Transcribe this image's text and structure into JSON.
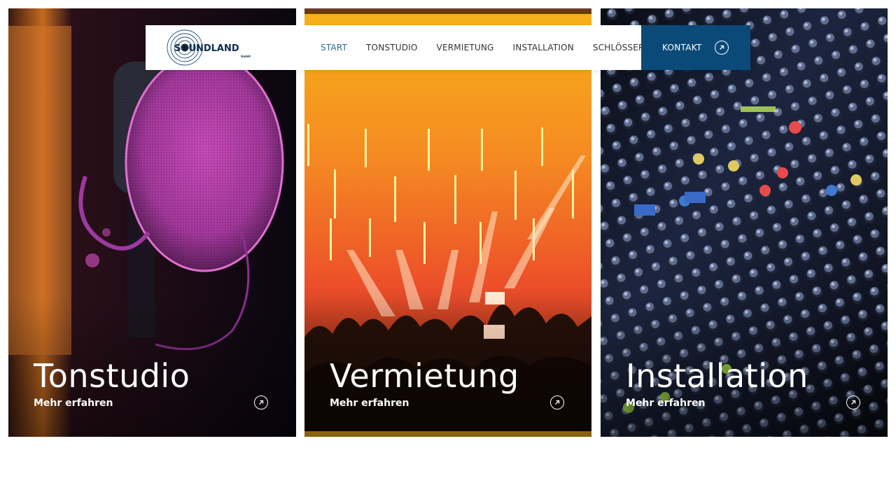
{
  "brand": {
    "name": "SOUNDLAND",
    "suffix": "GmbH"
  },
  "nav": {
    "items": [
      {
        "label": "START",
        "active": true
      },
      {
        "label": "TONSTUDIO",
        "active": false
      },
      {
        "label": "VERMIETUNG",
        "active": false
      },
      {
        "label": "INSTALLATION",
        "active": false
      },
      {
        "label": "SCHLÖSSER TV",
        "active": false
      }
    ],
    "cta_label": "KONTAKT",
    "cta_icon": "arrow-up-right-icon"
  },
  "panels": [
    {
      "title": "Tonstudio",
      "link": "Mehr erfahren",
      "image": "studio-microphone-pop-filter",
      "icon": "arrow-up-right-icon"
    },
    {
      "title": "Vermietung",
      "link": "Mehr erfahren",
      "image": "concert-crowd-stage-lights",
      "icon": "arrow-up-right-icon"
    },
    {
      "title": "Installation",
      "link": "Mehr erfahren",
      "image": "audio-mixing-console",
      "icon": "arrow-up-right-icon"
    }
  ],
  "colors": {
    "accent": "#0b4a78",
    "active_nav": "#2a6f97",
    "nav_text": "#333333",
    "overlay_text": "#ffffff"
  }
}
